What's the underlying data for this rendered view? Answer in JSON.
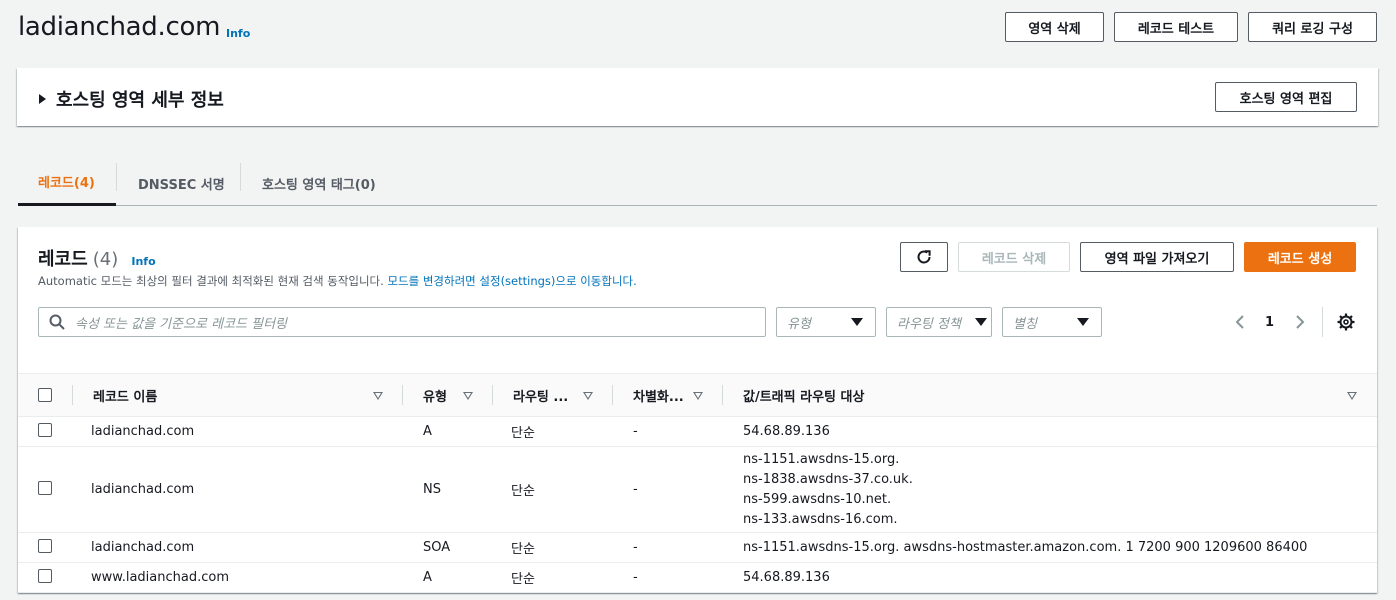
{
  "header": {
    "title": "ladianchad.com",
    "info": "Info",
    "buttons": {
      "delete_zone": "영역 삭제",
      "test_record": "레코드 테스트",
      "query_logging": "쿼리 로깅 구성"
    }
  },
  "details": {
    "label": "호스팅 영역 세부 정보",
    "edit_button": "호스팅 영역 편집"
  },
  "tabs": [
    {
      "label": "레코드(4)",
      "active": true
    },
    {
      "label": "DNSSEC 서명",
      "active": false
    },
    {
      "label": "호스팅 영역 태그(0)",
      "active": false
    }
  ],
  "records": {
    "title": "레코드",
    "count": "(4)",
    "info": "Info",
    "description_prefix": "Automatic 모드는 최상의 필터 결과에 최적화된 현재 검색 동작입니다. ",
    "description_link": "모드를 변경하려면 설정(settings)으로 이동합니다.",
    "buttons": {
      "refresh_icon": "refresh-icon",
      "delete": "레코드 삭제",
      "import_zone": "영역 파일 가져오기",
      "create": "레코드 생성"
    },
    "search_placeholder": "속성 또는 값을 기준으로 레코드 필터링",
    "filters": {
      "type": "유형",
      "routing_policy": "라우팅 정책",
      "alias": "별칭"
    },
    "pagination": {
      "page": "1"
    },
    "columns": [
      "레코드 이름",
      "유형",
      "라우팅 ...",
      "차별화...",
      "값/트래픽 라우팅 대상"
    ],
    "rows": [
      {
        "name": "ladianchad.com",
        "type": "A",
        "routing": "단순",
        "diff": "-",
        "values": [
          "54.68.89.136"
        ]
      },
      {
        "name": "ladianchad.com",
        "type": "NS",
        "routing": "단순",
        "diff": "-",
        "values": [
          "ns-1151.awsdns-15.org.",
          "ns-1838.awsdns-37.co.uk.",
          "ns-599.awsdns-10.net.",
          "ns-133.awsdns-16.com."
        ]
      },
      {
        "name": "ladianchad.com",
        "type": "SOA",
        "routing": "단순",
        "diff": "-",
        "values": [
          "ns-1151.awsdns-15.org. awsdns-hostmaster.amazon.com. 1 7200 900 1209600 86400"
        ]
      },
      {
        "name": "www.ladianchad.com",
        "type": "A",
        "routing": "단순",
        "diff": "-",
        "values": [
          "54.68.89.136"
        ]
      }
    ]
  },
  "colors": {
    "accent": "#ec7211",
    "link": "#0073bb",
    "border": "#aab7b8"
  }
}
